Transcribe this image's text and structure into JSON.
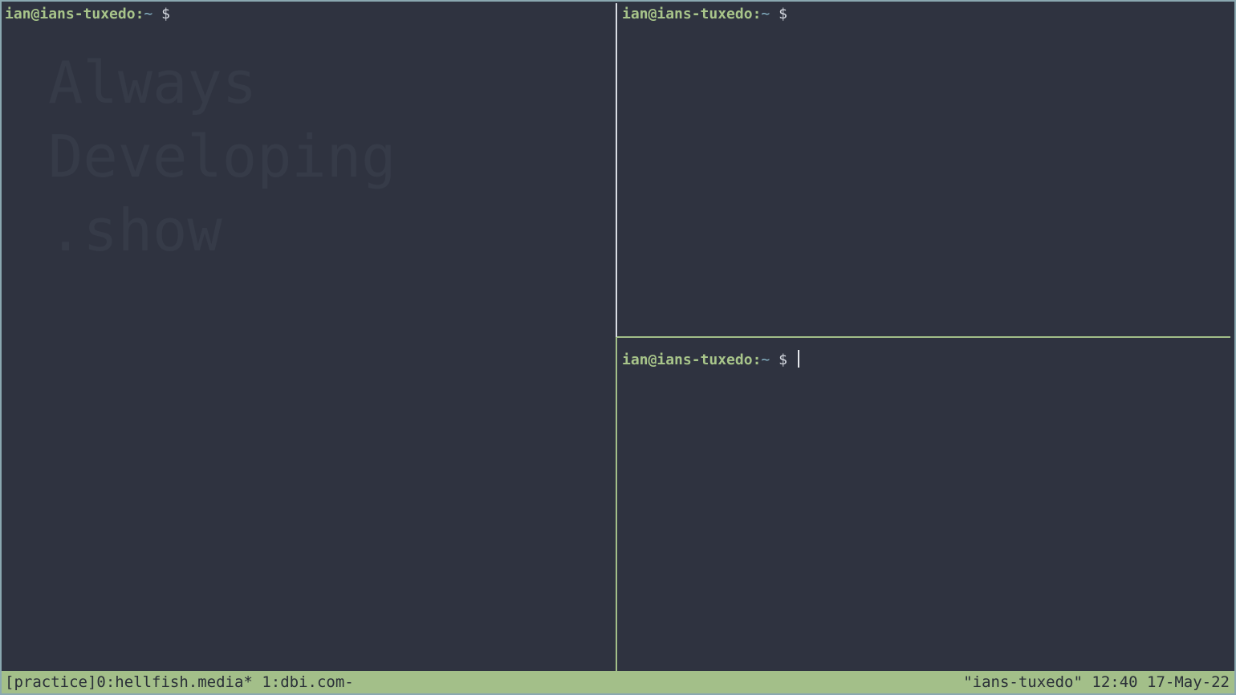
{
  "watermark": {
    "line1": "Always",
    "line2": "Developing",
    "line3": ".show"
  },
  "prompt": {
    "user": "ian",
    "at": "@",
    "host": "ians-tuxedo",
    "colon": ":",
    "path": "~",
    "symbol": "$"
  },
  "status_bar": {
    "session": "[practice]",
    "window0": "0:hellfish.media*",
    "window1": "1:dbi.com-",
    "hostname": "\"ians-tuxedo\"",
    "time": "12:40",
    "date": "17-May-22"
  },
  "colors": {
    "background": "#2f3340",
    "prompt_green": "#a8c58a",
    "path_blue": "#88b6c8",
    "status_bar": "#a3bf89",
    "active_border": "#a3bf89",
    "inactive_border": "#d9dde4"
  }
}
